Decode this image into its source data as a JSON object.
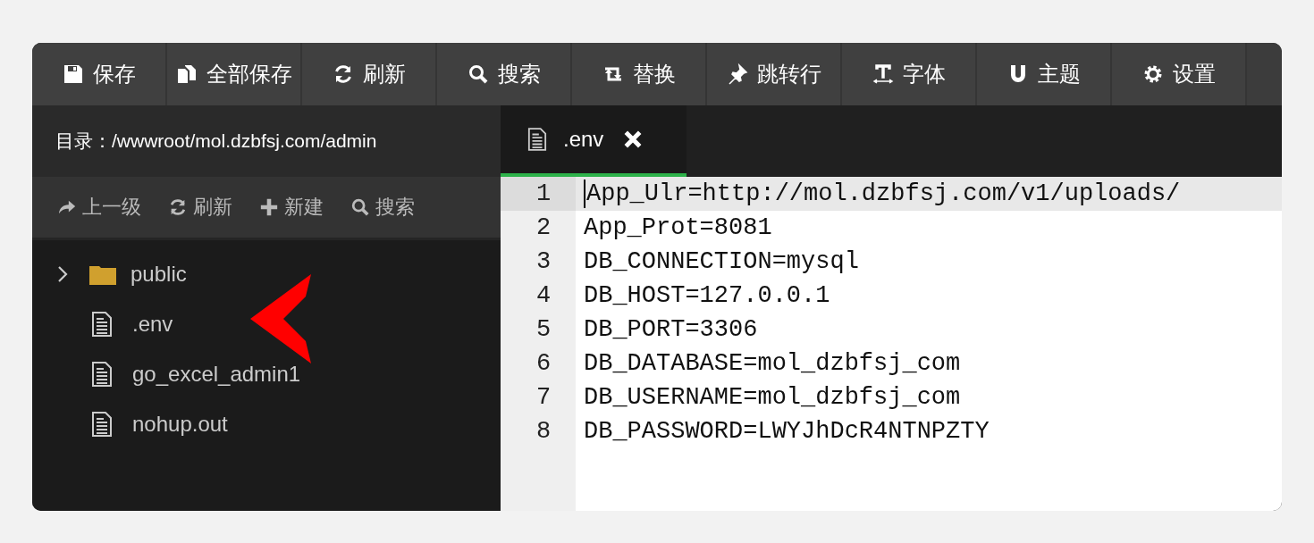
{
  "toolbar": [
    {
      "label": "保存"
    },
    {
      "label": "全部保存"
    },
    {
      "label": "刷新"
    },
    {
      "label": "搜索"
    },
    {
      "label": "替换"
    },
    {
      "label": "跳转行"
    },
    {
      "label": "字体"
    },
    {
      "label": "主题"
    },
    {
      "label": "设置"
    }
  ],
  "sidebar": {
    "path": "目录：/wwwroot/mol.dzbfsj.com/admin",
    "actions": [
      {
        "label": "上一级"
      },
      {
        "label": "刷新"
      },
      {
        "label": "新建"
      },
      {
        "label": "搜索"
      }
    ],
    "tree": [
      {
        "kind": "folder",
        "name": "public",
        "expanded": false
      },
      {
        "kind": "file",
        "name": ".env"
      },
      {
        "kind": "file",
        "name": "go_excel_admin1"
      },
      {
        "kind": "file",
        "name": "nohup.out"
      }
    ]
  },
  "tabs": [
    {
      "label": ".env",
      "selected": true
    }
  ],
  "editor": {
    "lines": [
      {
        "number": "1",
        "text": "App_Ulr=http://mol.dzbfsj.com/v1/uploads/",
        "current": true
      },
      {
        "number": "2",
        "text": "App_Prot=8081",
        "current": false
      },
      {
        "number": "3",
        "text": "DB_CONNECTION=mysql",
        "current": false
      },
      {
        "number": "4",
        "text": "DB_HOST=127.0.0.1",
        "current": false
      },
      {
        "number": "5",
        "text": "DB_PORT=3306",
        "current": false
      },
      {
        "number": "6",
        "text": "DB_DATABASE=mol_dzbfsj_com",
        "current": false
      },
      {
        "number": "7",
        "text": "DB_USERNAME=mol_dzbfsj_com",
        "current": false
      },
      {
        "number": "8",
        "text": "DB_PASSWORD=LWYJhDcR4NTNPZTY",
        "current": false
      }
    ]
  }
}
